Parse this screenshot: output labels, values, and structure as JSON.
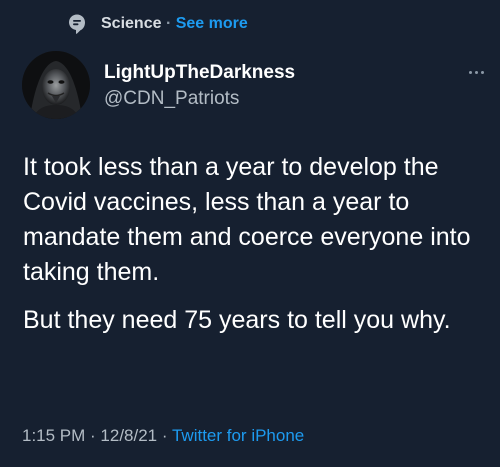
{
  "topic": {
    "icon": "topic-icon",
    "name": "Science",
    "separator": "·",
    "see_more": "See more"
  },
  "author": {
    "display_name": "LightUpTheDarkness",
    "handle": "@CDN_Patriots"
  },
  "tweet": {
    "paragraphs": [
      "It took less than a year to develop the Covid vaccines, less than a year to mandate them and coerce everyone into taking them.",
      "But they need 75 years to tell you why."
    ]
  },
  "meta": {
    "time": "1:15 PM",
    "sep1": " · ",
    "date": "12/8/21",
    "sep2": " · ",
    "source": "Twitter for iPhone"
  },
  "colors": {
    "background": "#162030",
    "text": "#ffffff",
    "secondary": "#b3bcc5",
    "link": "#1d9bf0"
  }
}
